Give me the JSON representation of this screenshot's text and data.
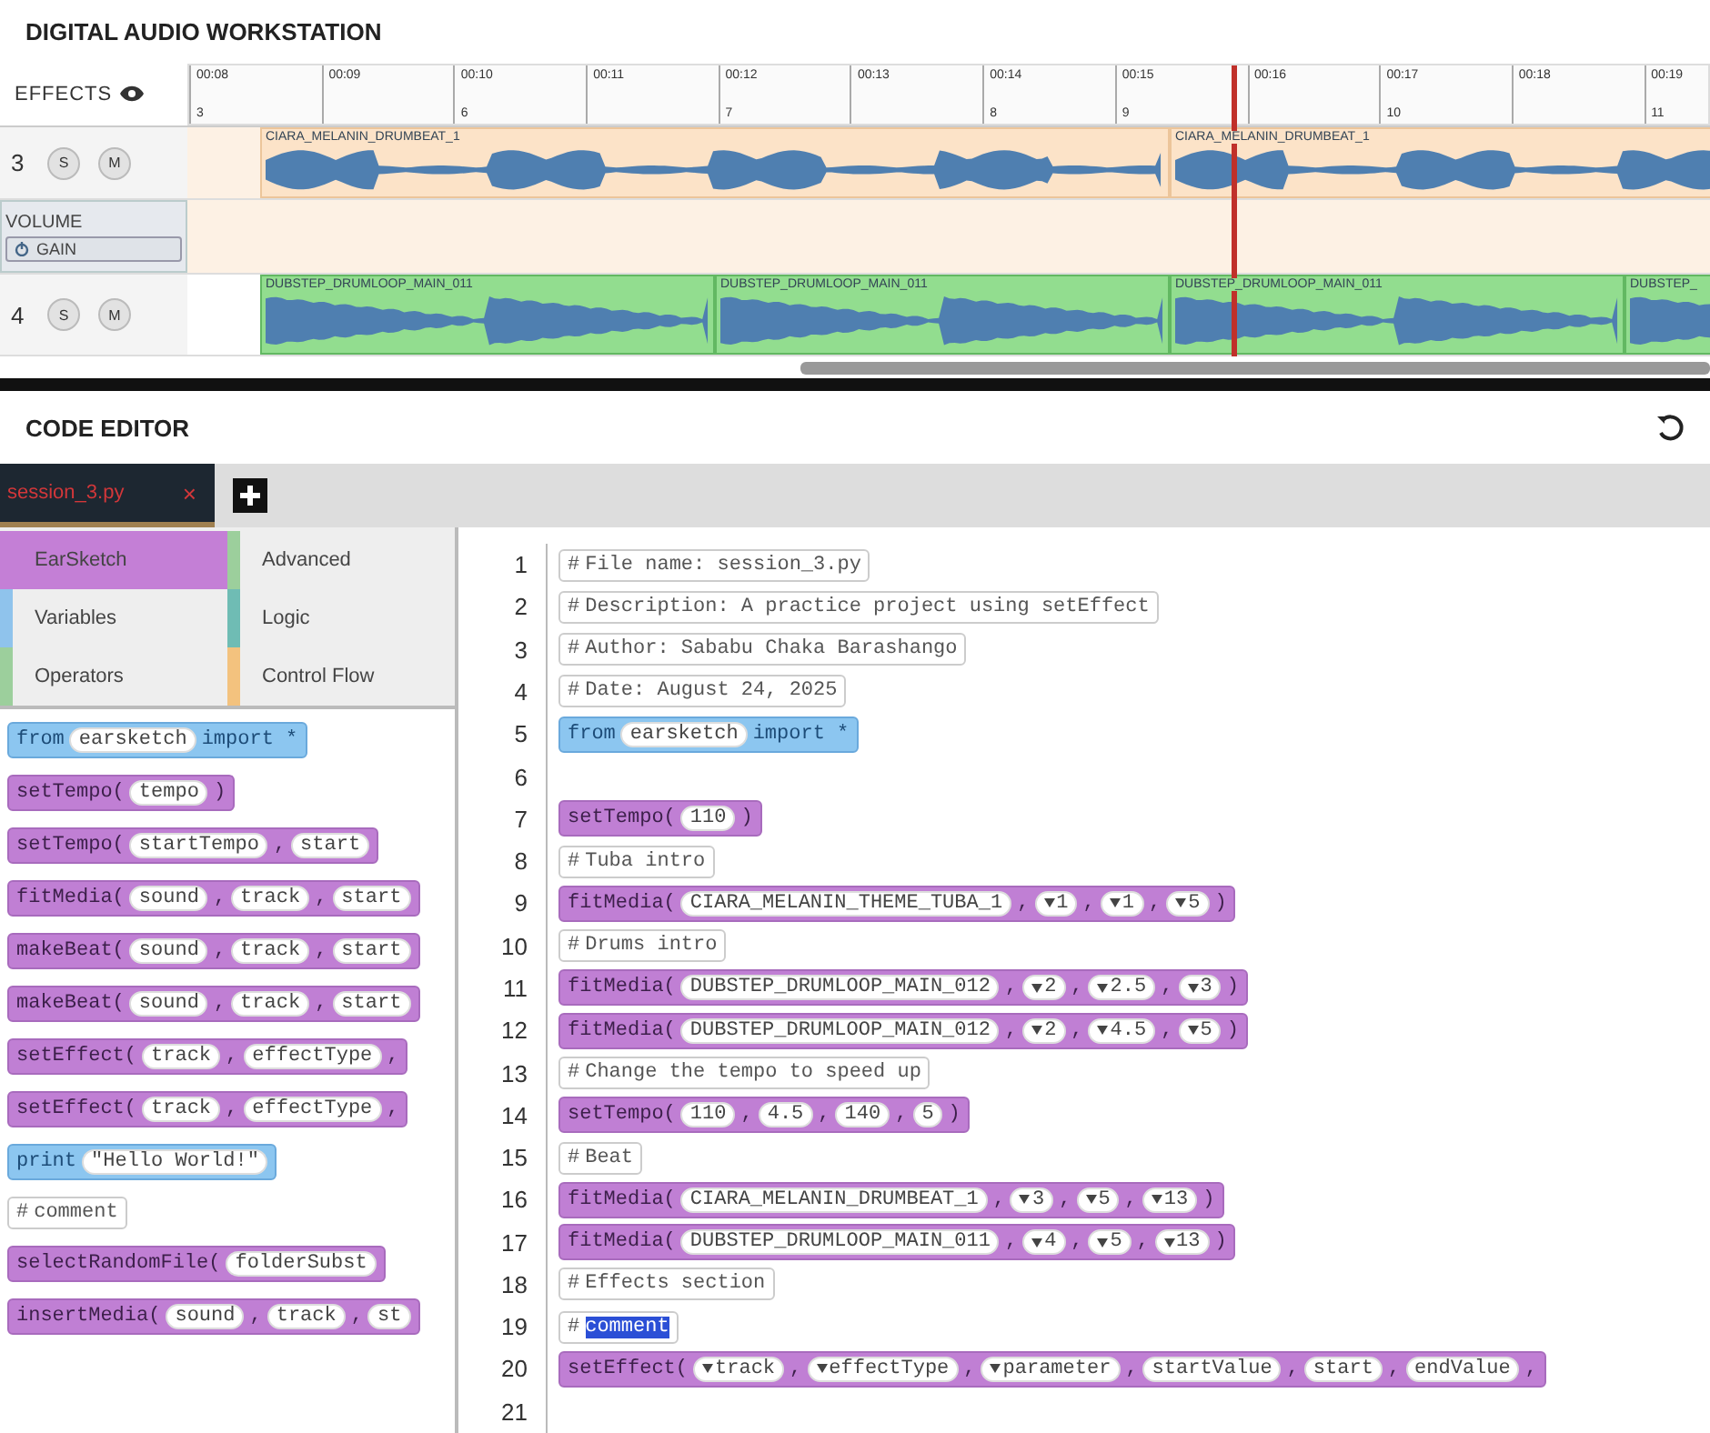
{
  "daw": {
    "title": "DIGITAL AUDIO WORKSTATION",
    "effects_label": "EFFECTS",
    "ruler": {
      "ticks": [
        {
          "time": "00:08",
          "measure": "3"
        },
        {
          "time": "00:09"
        },
        {
          "time": "00:10",
          "measure": "6"
        },
        {
          "time": "00:11"
        },
        {
          "time": "00:12",
          "measure": "7"
        },
        {
          "time": "00:13"
        },
        {
          "time": "00:14",
          "measure": "8"
        },
        {
          "time": "00:15",
          "measure": "9"
        },
        {
          "time": "00:16"
        },
        {
          "time": "00:17",
          "measure": "10"
        },
        {
          "time": "00:18"
        },
        {
          "time": "00:19",
          "measure": "11"
        }
      ]
    },
    "tracks": [
      {
        "number": "3",
        "solo": "S",
        "mute": "M",
        "kind": "drums",
        "clips": [
          {
            "name": "CIARA_MELANIN_DRUMBEAT_1"
          },
          {
            "name": "CIARA_MELANIN_DRUMBEAT_1"
          }
        ],
        "effect": {
          "name": "VOLUME",
          "button": "GAIN"
        }
      },
      {
        "number": "4",
        "solo": "S",
        "mute": "M",
        "kind": "loop",
        "clips": [
          {
            "name": "DUBSTEP_DRUMLOOP_MAIN_011"
          },
          {
            "name": "DUBSTEP_DRUMLOOP_MAIN_011"
          },
          {
            "name": "DUBSTEP_DRUMLOOP_MAIN_011"
          },
          {
            "name": "DUBSTEP_"
          }
        ]
      }
    ]
  },
  "editor": {
    "title": "CODE EDITOR",
    "tabs": [
      {
        "label": "session_3.py",
        "close": "×",
        "selected": true
      }
    ],
    "palette": {
      "categories": [
        {
          "label": "EarSketch",
          "color": "#c47fd6",
          "selected": true
        },
        {
          "label": "Advanced",
          "color": "#9ccf9c",
          "selected": false
        },
        {
          "label": "Variables",
          "color": "#8fc3ec",
          "selected": false
        },
        {
          "label": "Logic",
          "color": "#6fbcb4",
          "selected": false
        },
        {
          "label": "Operators",
          "color": "#9ccf9c",
          "selected": false
        },
        {
          "label": "Control Flow",
          "color": "#f3c27e",
          "selected": false
        }
      ],
      "blocks": [
        {
          "kind": "import",
          "words": [
            "from",
            "earsketch",
            "import *"
          ]
        },
        {
          "kind": "call",
          "name": "setTempo(",
          "close": ")",
          "args": [
            {
              "text": "tempo",
              "dropdown": false
            }
          ]
        },
        {
          "kind": "call",
          "name": "setTempo(",
          "sep": ",",
          "args": [
            {
              "text": "startTempo",
              "dropdown": false
            },
            {
              "text": "start",
              "dropdown": false
            }
          ]
        },
        {
          "kind": "call",
          "name": "fitMedia(",
          "sep": ",",
          "args": [
            {
              "text": "sound",
              "dropdown": false
            },
            {
              "text": "track",
              "dropdown": false
            },
            {
              "text": "start",
              "dropdown": false
            }
          ]
        },
        {
          "kind": "call",
          "name": "makeBeat(",
          "sep": ",",
          "args": [
            {
              "text": "sound",
              "dropdown": false
            },
            {
              "text": "track",
              "dropdown": false
            },
            {
              "text": "start",
              "dropdown": false
            }
          ]
        },
        {
          "kind": "call",
          "name": "makeBeat(",
          "sep": ",",
          "args": [
            {
              "text": "sound",
              "dropdown": false
            },
            {
              "text": "track",
              "dropdown": false
            },
            {
              "text": "start",
              "dropdown": false
            }
          ]
        },
        {
          "kind": "call",
          "name": "setEffect(",
          "sep": ",",
          "trail": true,
          "args": [
            {
              "text": "track",
              "dropdown": false
            },
            {
              "text": "effectType",
              "dropdown": false
            }
          ]
        },
        {
          "kind": "call",
          "name": "setEffect(",
          "sep": ",",
          "trail": true,
          "args": [
            {
              "text": "track",
              "dropdown": false
            },
            {
              "text": "effectType",
              "dropdown": false
            }
          ]
        },
        {
          "kind": "print",
          "keyword": "print",
          "arg": "\"Hello World!\""
        },
        {
          "kind": "comment",
          "mark": "#",
          "text": "comment",
          "selected": false
        },
        {
          "kind": "call",
          "name": "selectRandomFile(",
          "args": [
            {
              "text": "folderSubst",
              "dropdown": false
            }
          ]
        },
        {
          "kind": "call",
          "name": "insertMedia(",
          "sep": ",",
          "args": [
            {
              "text": "sound",
              "dropdown": false
            },
            {
              "text": "track",
              "dropdown": false
            },
            {
              "text": "st",
              "dropdown": false
            }
          ]
        }
      ]
    },
    "code": {
      "lines": [
        {
          "number": "1",
          "kind": "comment",
          "mark": "#",
          "text": "File name: session_3.py",
          "selected": false
        },
        {
          "number": "2",
          "kind": "comment",
          "mark": "#",
          "text": "Description: A practice project using setEffect",
          "selected": false
        },
        {
          "number": "3",
          "kind": "comment",
          "mark": "#",
          "text": "Author: Sababu Chaka Barashango",
          "selected": false
        },
        {
          "number": "4",
          "kind": "comment",
          "mark": "#",
          "text": "Date: August 24, 2025",
          "selected": false
        },
        {
          "number": "5",
          "kind": "import",
          "words": [
            "from",
            "earsketch",
            "import *"
          ]
        },
        {
          "number": "6",
          "kind": "empty"
        },
        {
          "number": "7",
          "kind": "call",
          "name": "setTempo(",
          "close": ")",
          "args": [
            {
              "text": "110",
              "dropdown": false
            }
          ]
        },
        {
          "number": "8",
          "kind": "comment",
          "mark": "#",
          "text": "Tuba intro",
          "selected": false
        },
        {
          "number": "9",
          "kind": "call",
          "name": "fitMedia(",
          "sep": ",",
          "close": ")",
          "args": [
            {
              "text": "CIARA_MELANIN_THEME_TUBA_1",
              "dropdown": false
            },
            {
              "text": "1",
              "dropdown": true
            },
            {
              "text": "1",
              "dropdown": true
            },
            {
              "text": "5",
              "dropdown": true
            }
          ]
        },
        {
          "number": "10",
          "kind": "comment",
          "mark": "#",
          "text": "Drums intro",
          "selected": false
        },
        {
          "number": "11",
          "kind": "call",
          "name": "fitMedia(",
          "sep": ",",
          "close": ")",
          "args": [
            {
              "text": "DUBSTEP_DRUMLOOP_MAIN_012",
              "dropdown": false
            },
            {
              "text": "2",
              "dropdown": true
            },
            {
              "text": "2.5",
              "dropdown": true
            },
            {
              "text": "3",
              "dropdown": true
            }
          ]
        },
        {
          "number": "12",
          "kind": "call",
          "name": "fitMedia(",
          "sep": ",",
          "close": ")",
          "args": [
            {
              "text": "DUBSTEP_DRUMLOOP_MAIN_012",
              "dropdown": false
            },
            {
              "text": "2",
              "dropdown": true
            },
            {
              "text": "4.5",
              "dropdown": true
            },
            {
              "text": "5",
              "dropdown": true
            }
          ]
        },
        {
          "number": "13",
          "kind": "comment",
          "mark": "#",
          "text": "Change the tempo to speed up",
          "selected": false
        },
        {
          "number": "14",
          "kind": "call",
          "name": "setTempo(",
          "sep": ",",
          "close": ")",
          "args": [
            {
              "text": "110",
              "dropdown": false
            },
            {
              "text": "4.5",
              "dropdown": false
            },
            {
              "text": "140",
              "dropdown": false
            },
            {
              "text": "5",
              "dropdown": false
            }
          ]
        },
        {
          "number": "15",
          "kind": "comment",
          "mark": "#",
          "text": "Beat",
          "selected": false
        },
        {
          "number": "16",
          "kind": "call",
          "name": "fitMedia(",
          "sep": ",",
          "close": ")",
          "args": [
            {
              "text": "CIARA_MELANIN_DRUMBEAT_1",
              "dropdown": false
            },
            {
              "text": "3",
              "dropdown": true
            },
            {
              "text": "5",
              "dropdown": true
            },
            {
              "text": "13",
              "dropdown": true
            }
          ]
        },
        {
          "number": "17",
          "kind": "call",
          "name": "fitMedia(",
          "sep": ",",
          "close": ")",
          "args": [
            {
              "text": "DUBSTEP_DRUMLOOP_MAIN_011",
              "dropdown": false
            },
            {
              "text": "4",
              "dropdown": true
            },
            {
              "text": "5",
              "dropdown": true
            },
            {
              "text": "13",
              "dropdown": true
            }
          ]
        },
        {
          "number": "18",
          "kind": "comment",
          "mark": "#",
          "text": "Effects section",
          "selected": false
        },
        {
          "number": "19",
          "kind": "comment",
          "mark": "#",
          "text": "comment",
          "selected": true
        },
        {
          "number": "20",
          "kind": "call",
          "name": "setEffect(",
          "sep": ",",
          "trail": true,
          "args": [
            {
              "text": "track",
              "dropdown": true
            },
            {
              "text": "effectType",
              "dropdown": true
            },
            {
              "text": "parameter",
              "dropdown": true
            },
            {
              "text": "startValue",
              "dropdown": false
            },
            {
              "text": "start",
              "dropdown": false
            },
            {
              "text": "endValue",
              "dropdown": false
            }
          ]
        },
        {
          "number": "21",
          "kind": "empty"
        }
      ]
    }
  }
}
